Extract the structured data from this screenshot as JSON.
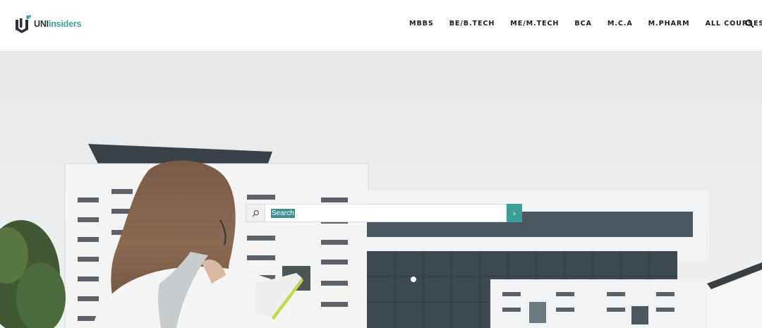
{
  "brand": {
    "name_part1": "UNI",
    "name_part2": "insiders",
    "accent": "#3aa6a3"
  },
  "nav": {
    "items": [
      {
        "label": "MBBS"
      },
      {
        "label": "BE/B.TECH"
      },
      {
        "label": "ME/M.TECH"
      },
      {
        "label": "BCA"
      },
      {
        "label": "M.C.A"
      },
      {
        "label": "M.PHARM"
      },
      {
        "label": "ALL COURSES"
      }
    ],
    "search_icon": "search-icon"
  },
  "hero_search": {
    "placeholder": "Search",
    "leading_icon": "search-icon",
    "submit_icon": "chevron-right-icon",
    "submit_color": "#3a9e9a"
  }
}
